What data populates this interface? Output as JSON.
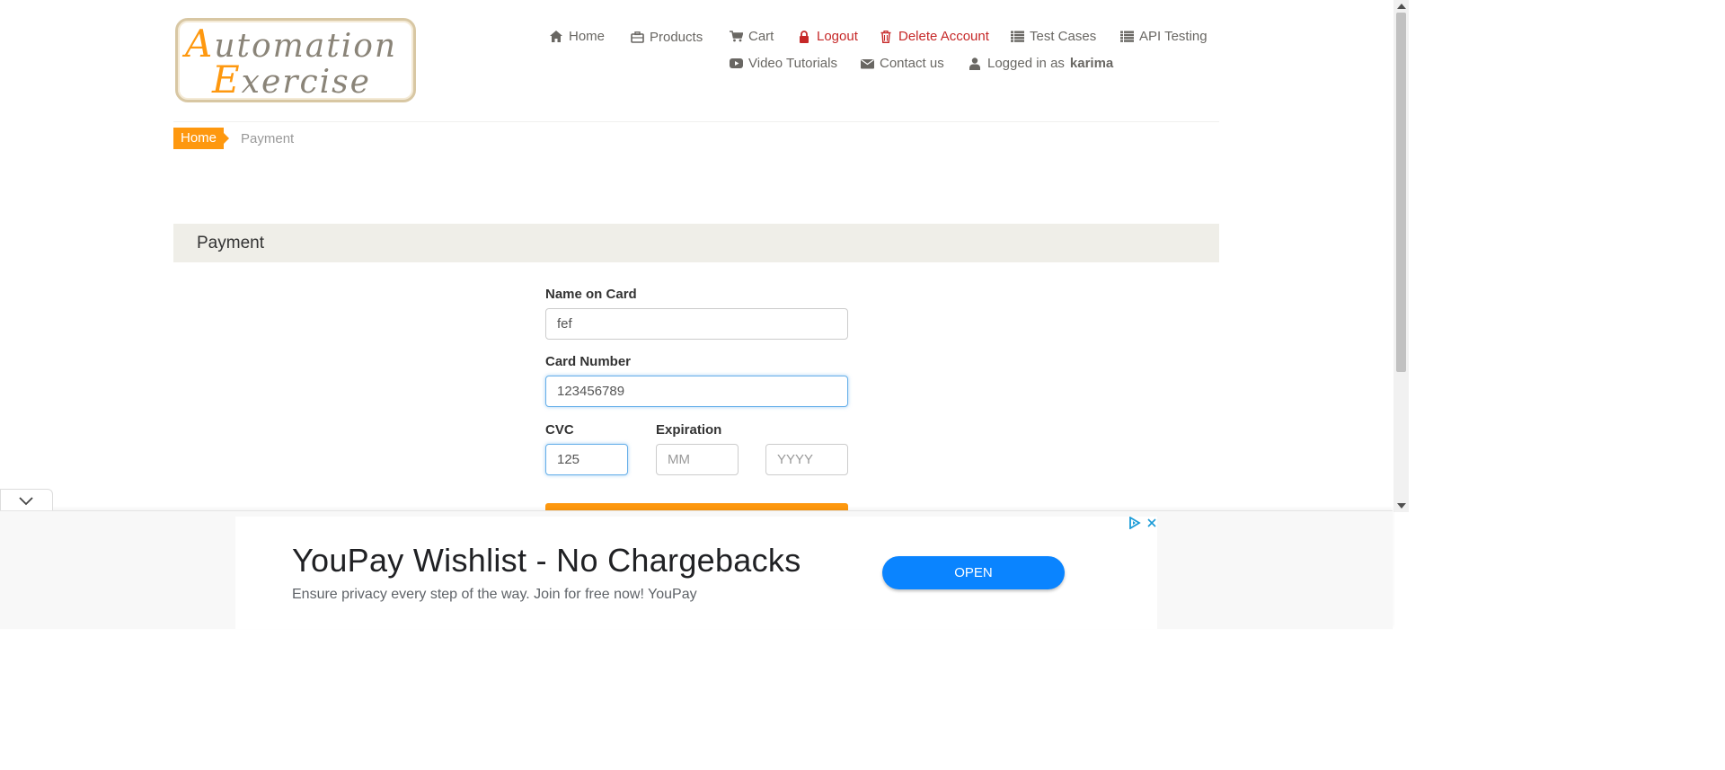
{
  "logo": {
    "line1_first": "A",
    "line1_rest": "utomation",
    "line2_first": "E",
    "line2_rest": "xercise"
  },
  "nav": {
    "home": "Home",
    "products": "Products",
    "cart": "Cart",
    "logout": "Logout",
    "delete_account": "Delete Account",
    "test_cases": "Test Cases",
    "api_testing": "API Testing",
    "video_tutorials": "Video Tutorials",
    "contact_us": "Contact us",
    "logged_in_prefix": "Logged in as",
    "username": "karima"
  },
  "breadcrumb": {
    "home": "Home",
    "current": "Payment"
  },
  "payment": {
    "heading": "Payment",
    "name_label": "Name on Card",
    "name_value": "fef",
    "card_label": "Card Number",
    "card_value": "123456789",
    "cvc_label": "CVC",
    "cvc_value": "125",
    "expiration_label": "Expiration",
    "month_placeholder": "MM",
    "year_placeholder": "YYYY"
  },
  "ad": {
    "title": "YouPay Wishlist - No Chargebacks",
    "subtitle": "Ensure privacy every step of the way. Join for free now! YouPay",
    "cta": "OPEN"
  },
  "colors": {
    "accent": "#fe980f",
    "danger": "#c62828",
    "ad_button": "#0a84ff"
  }
}
